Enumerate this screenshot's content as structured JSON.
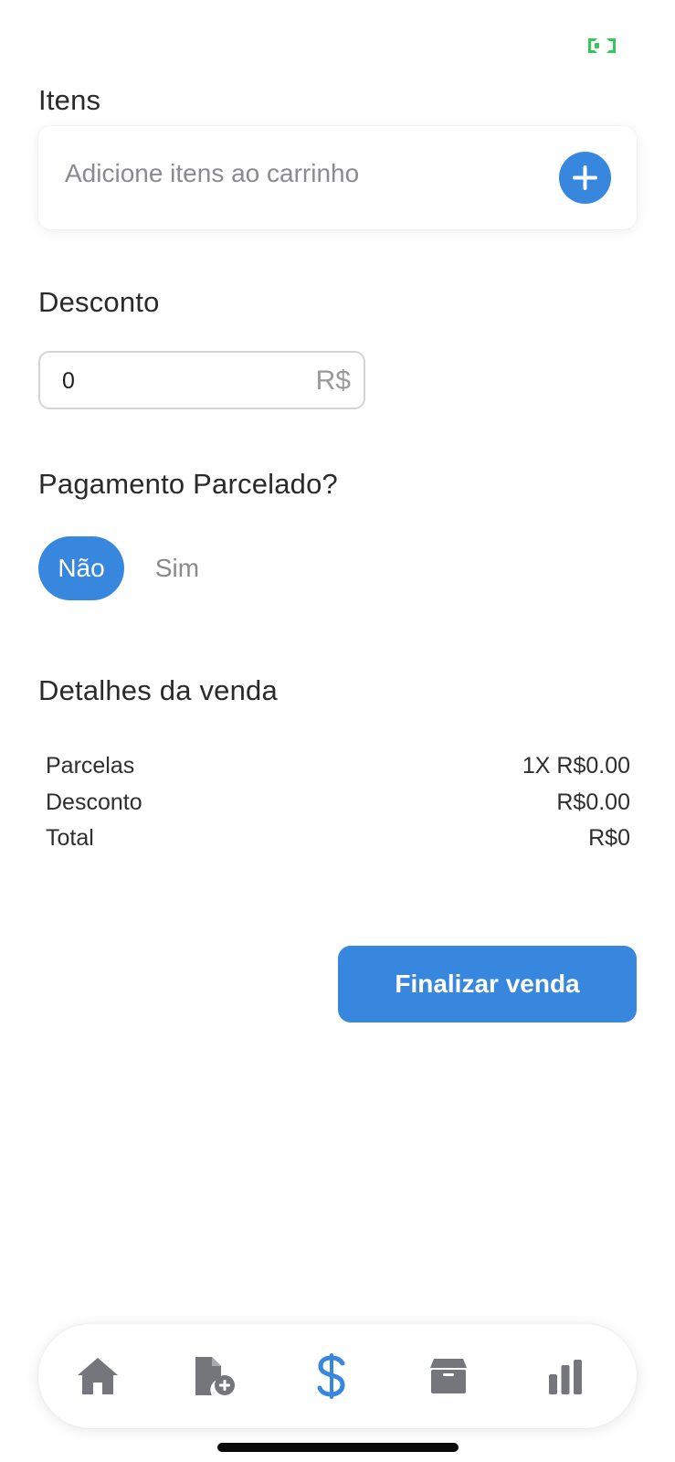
{
  "colors": {
    "accent": "#3787de",
    "status_green": "#34c759",
    "icon_gray": "#75757c"
  },
  "items": {
    "title": "Itens",
    "placeholder": "Adicione itens ao carrinho",
    "add_icon": "plus-icon"
  },
  "discount": {
    "title": "Desconto",
    "value": "0",
    "currency": "R$"
  },
  "installments": {
    "title": "Pagamento Parcelado?",
    "options": [
      {
        "label": "Não",
        "selected": true
      },
      {
        "label": "Sim",
        "selected": false
      }
    ]
  },
  "details": {
    "title": "Detalhes da venda",
    "rows": [
      {
        "label": "Parcelas",
        "value": "1X R$0.00"
      },
      {
        "label": "Desconto",
        "value": "R$0.00"
      },
      {
        "label": "Total",
        "value": "R$0"
      }
    ]
  },
  "finish_button": {
    "label": "Finalizar venda"
  },
  "bottom_nav": {
    "items": [
      {
        "icon": "home-icon",
        "active": false
      },
      {
        "icon": "add-file-icon",
        "active": false
      },
      {
        "icon": "dollar-icon",
        "active": true
      },
      {
        "icon": "box-icon",
        "active": false
      },
      {
        "icon": "bar-chart-icon",
        "active": false
      }
    ]
  }
}
